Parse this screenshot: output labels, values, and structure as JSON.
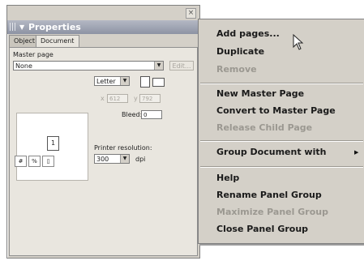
{
  "panel": {
    "title": "Properties",
    "collapse_arrow": "▼",
    "close_glyph": "×",
    "tabs": [
      {
        "label": "Object",
        "active": false
      },
      {
        "label": "Document",
        "active": true
      }
    ],
    "master_page_label": "Master page",
    "master_page_value": "None",
    "edit_button": "Edit...",
    "page_size_value": "Letter",
    "width_label": "x",
    "width_value": "612",
    "height_label": "y",
    "height_value": "792",
    "bleed_label": "Bleed:",
    "bleed_value": "0",
    "preview_page_number": "1",
    "printer_resolution_label": "Printer resolution:",
    "resolution_value": "300",
    "resolution_unit": "dpi"
  },
  "menu": {
    "items": [
      {
        "label": "Add pages...",
        "enabled": true
      },
      {
        "label": "Duplicate",
        "enabled": true
      },
      {
        "label": "Remove",
        "enabled": false
      },
      {
        "label": "New Master Page",
        "enabled": true
      },
      {
        "label": "Convert to Master Page",
        "enabled": true
      },
      {
        "label": "Release Child Page",
        "enabled": false
      },
      {
        "label": "Group Document with",
        "enabled": true,
        "has_submenu": true
      },
      {
        "label": "Help",
        "enabled": true
      },
      {
        "label": "Rename Panel Group",
        "enabled": true
      },
      {
        "label": "Maximize Panel Group",
        "enabled": false
      },
      {
        "label": "Close Panel Group",
        "enabled": true
      }
    ],
    "submenu_arrow": "▶"
  }
}
